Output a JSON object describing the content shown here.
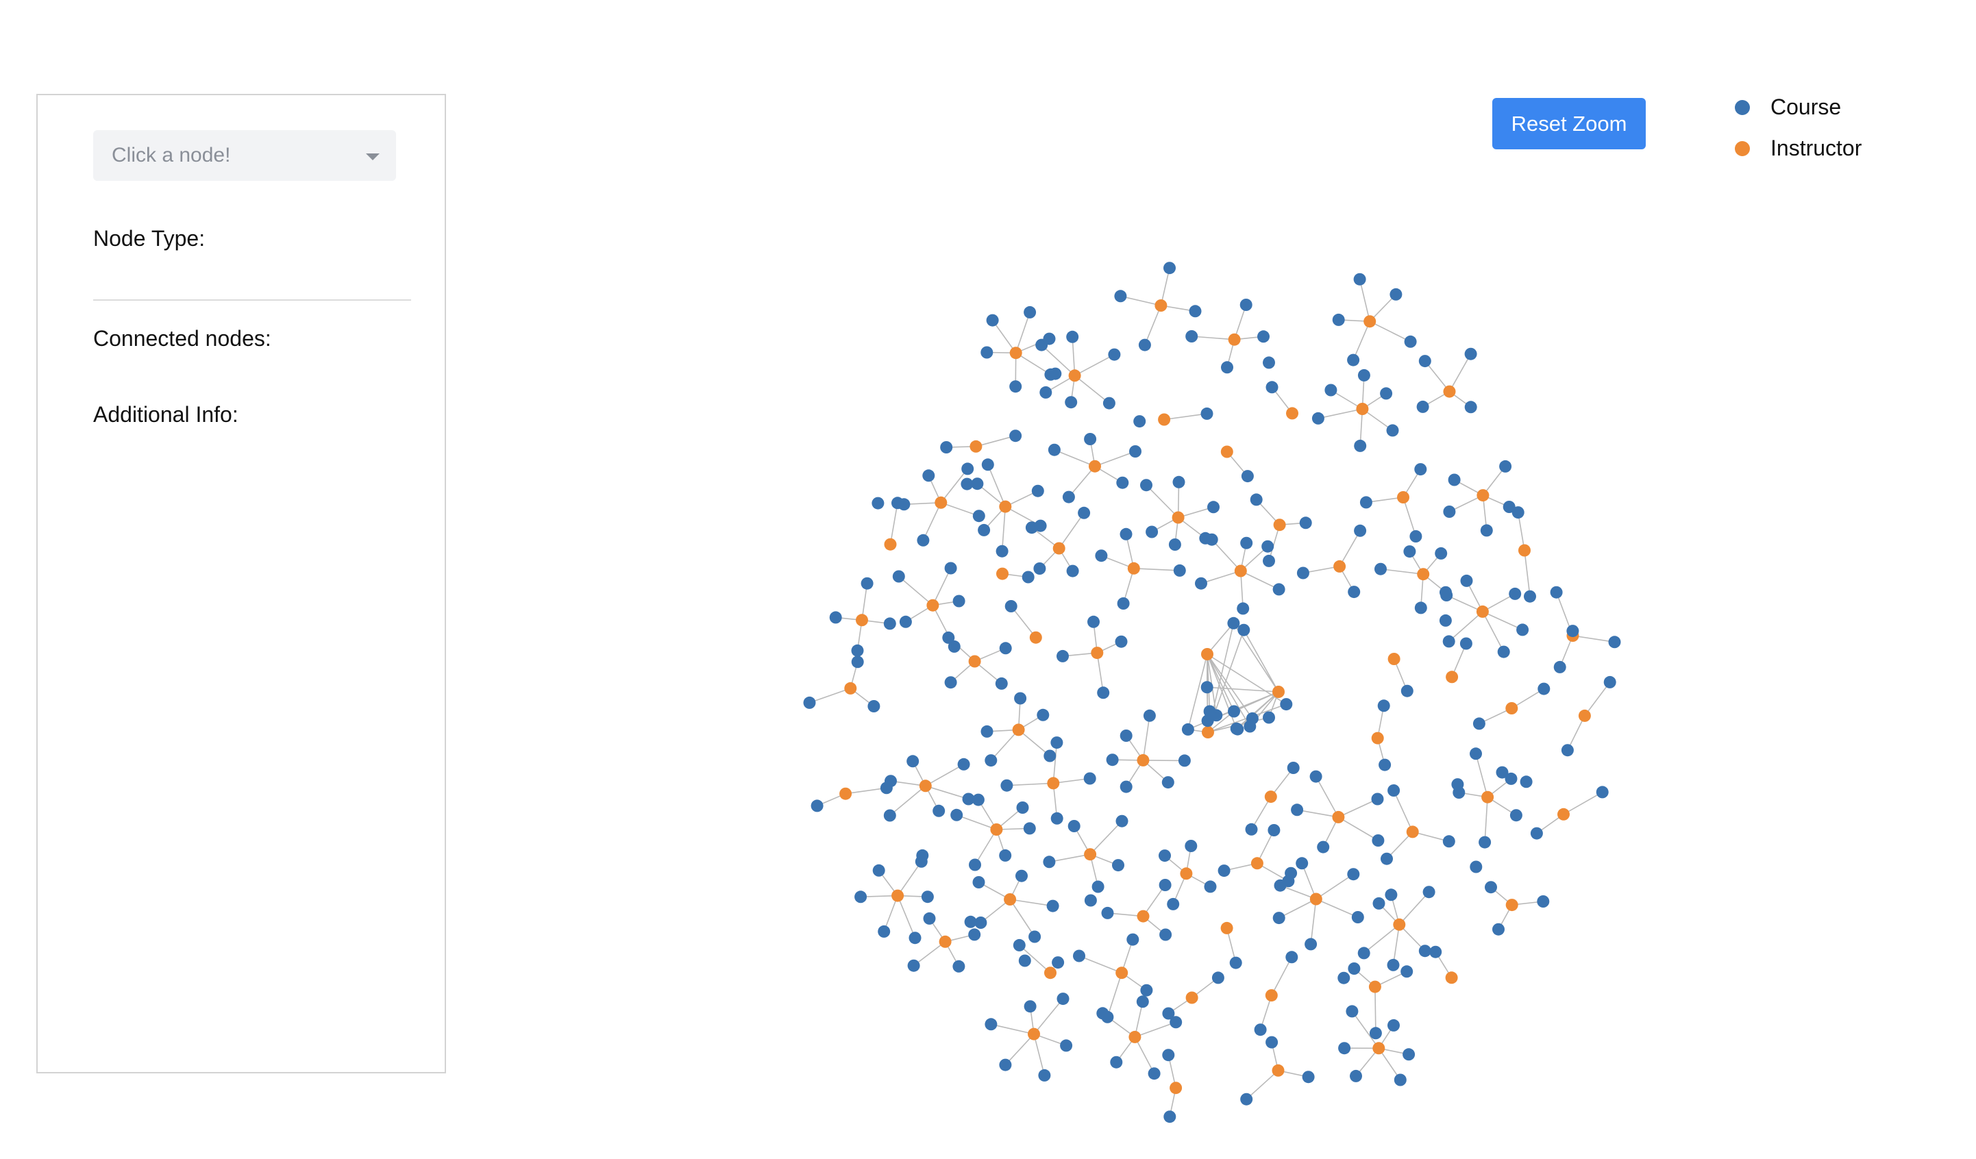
{
  "sidebar": {
    "select_placeholder": "Click a node!",
    "node_type_label": "Node Type:",
    "connected_nodes_label": "Connected nodes:",
    "additional_info_label": "Additional Info:"
  },
  "toolbar": {
    "reset_zoom_label": "Reset Zoom"
  },
  "legend": {
    "items": [
      {
        "label": "Course",
        "color": "#3a73b0"
      },
      {
        "label": "Instructor",
        "color": "#ee8a34"
      }
    ]
  },
  "colors": {
    "course": "#3a73b0",
    "instructor": "#ee8a34",
    "link": "#b9b9b9",
    "button": "#3a86f0"
  }
}
